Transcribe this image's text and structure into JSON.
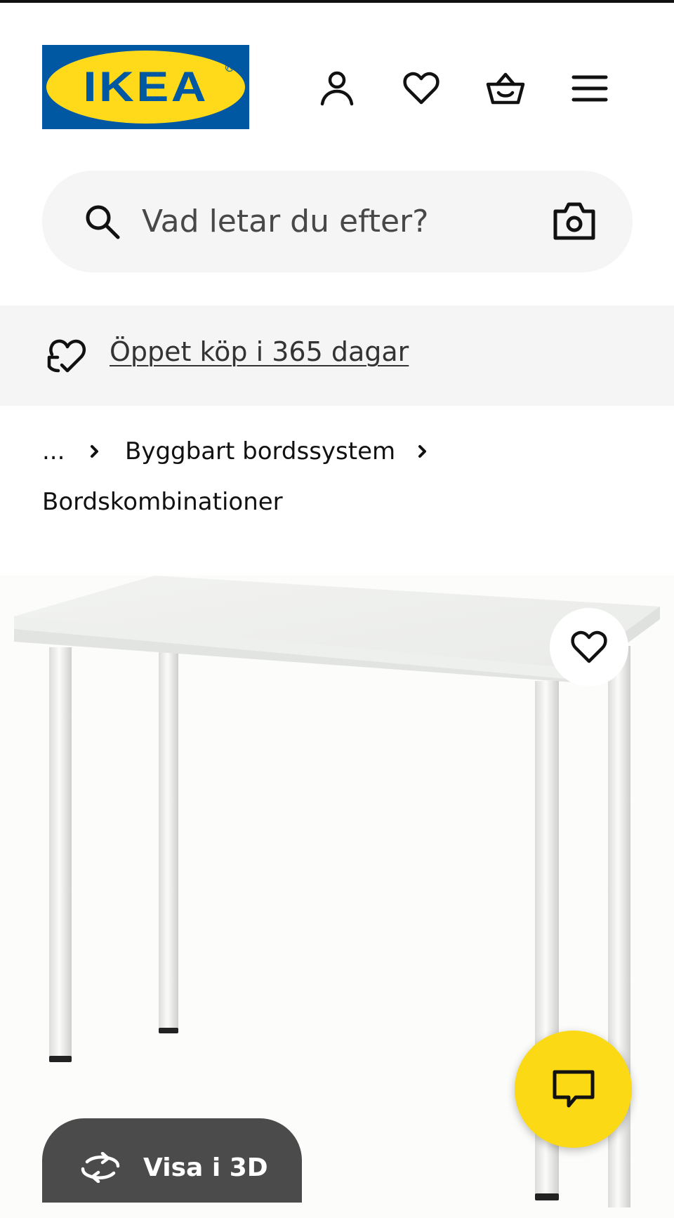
{
  "header": {
    "logo_text": "IKEA",
    "icons": [
      "user-icon",
      "heart-icon",
      "basket-icon",
      "menu-icon"
    ]
  },
  "search": {
    "placeholder": "Vad letar du efter?",
    "icons": [
      "search-icon",
      "camera-icon"
    ]
  },
  "promo": {
    "link_text": "Öppet köp i 365 dagar",
    "icon": "heart-return-icon"
  },
  "breadcrumb": {
    "ellipsis": "...",
    "items": [
      "Byggbart bordssystem",
      "Bordskombinationer"
    ]
  },
  "product": {
    "view3d_label": "Visa i 3D"
  },
  "colors": {
    "ikea_blue": "#0058a3",
    "ikea_yellow": "#ffda1a",
    "chat_yellow": "#fbd914",
    "pill_dark": "#4b4b4b",
    "bar_gray": "#f5f5f5"
  }
}
